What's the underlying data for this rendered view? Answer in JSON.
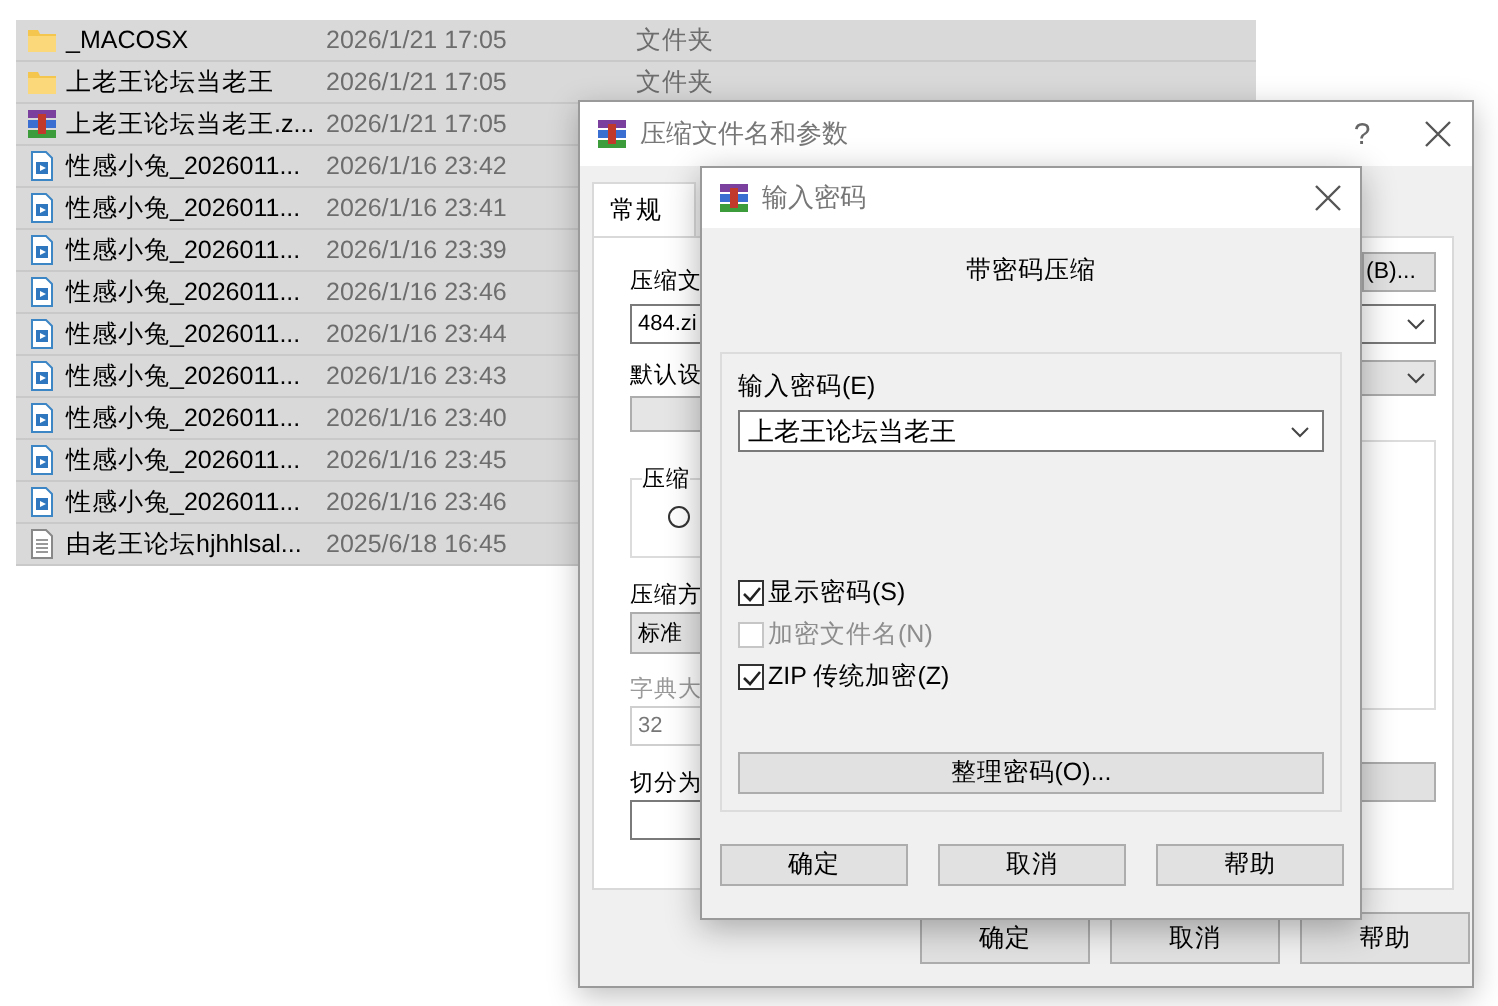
{
  "files": [
    {
      "kind": "folder",
      "name": "_MACOSX",
      "date": "2026/1/21 17:05",
      "type": "文件夹"
    },
    {
      "kind": "folder",
      "name": "上老王论坛当老王",
      "date": "2026/1/21 17:05",
      "type": "文件夹"
    },
    {
      "kind": "archive",
      "name": "上老王论坛当老王.z...",
      "date": "2026/1/21 17:05"
    },
    {
      "kind": "video",
      "name": "性感小兔_2026011...",
      "date": "2026/1/16 23:42"
    },
    {
      "kind": "video",
      "name": "性感小兔_2026011...",
      "date": "2026/1/16 23:41"
    },
    {
      "kind": "video",
      "name": "性感小兔_2026011...",
      "date": "2026/1/16 23:39"
    },
    {
      "kind": "video",
      "name": "性感小兔_2026011...",
      "date": "2026/1/16 23:46"
    },
    {
      "kind": "video",
      "name": "性感小兔_2026011...",
      "date": "2026/1/16 23:44"
    },
    {
      "kind": "video",
      "name": "性感小兔_2026011...",
      "date": "2026/1/16 23:43"
    },
    {
      "kind": "video",
      "name": "性感小兔_2026011...",
      "date": "2026/1/16 23:40"
    },
    {
      "kind": "video",
      "name": "性感小兔_2026011...",
      "date": "2026/1/16 23:45"
    },
    {
      "kind": "video",
      "name": "性感小兔_2026011...",
      "date": "2026/1/16 23:46"
    },
    {
      "kind": "text",
      "name": "由老王论坛hjhhlsal...",
      "date": "2025/6/18 16:45"
    }
  ],
  "archive_dialog": {
    "title": "压缩文件名和参数",
    "help_button": "?",
    "tabs": [
      {
        "label": "常规",
        "selected": true
      }
    ],
    "archive_name": {
      "label": "压缩文",
      "value": "484.zi"
    },
    "browse_button": "(B)...",
    "profile": {
      "label": "默认设"
    },
    "archive_format": {
      "label": "压缩",
      "option_selected": false
    },
    "compression_method": {
      "label": "压缩方",
      "value": "标准"
    },
    "dictionary_size": {
      "label": "字典大",
      "value": "32",
      "disabled": true
    },
    "split": {
      "label": "切分为"
    },
    "buttons": [
      "确定",
      "取消",
      "帮助"
    ]
  },
  "password_dialog": {
    "title": "输入密码",
    "heading": "带密码压缩",
    "password": {
      "label": "输入密码(E)",
      "value": "上老王论坛当老王"
    },
    "options": [
      {
        "label": "显示密码(S)",
        "checked": true,
        "disabled": false
      },
      {
        "label": "加密文件名(N)",
        "checked": false,
        "disabled": true
      },
      {
        "label": "ZIP 传统加密(Z)",
        "checked": true,
        "disabled": false
      }
    ],
    "organize_button": "整理密码(O)...",
    "buttons": [
      "确定",
      "取消",
      "帮助"
    ]
  }
}
